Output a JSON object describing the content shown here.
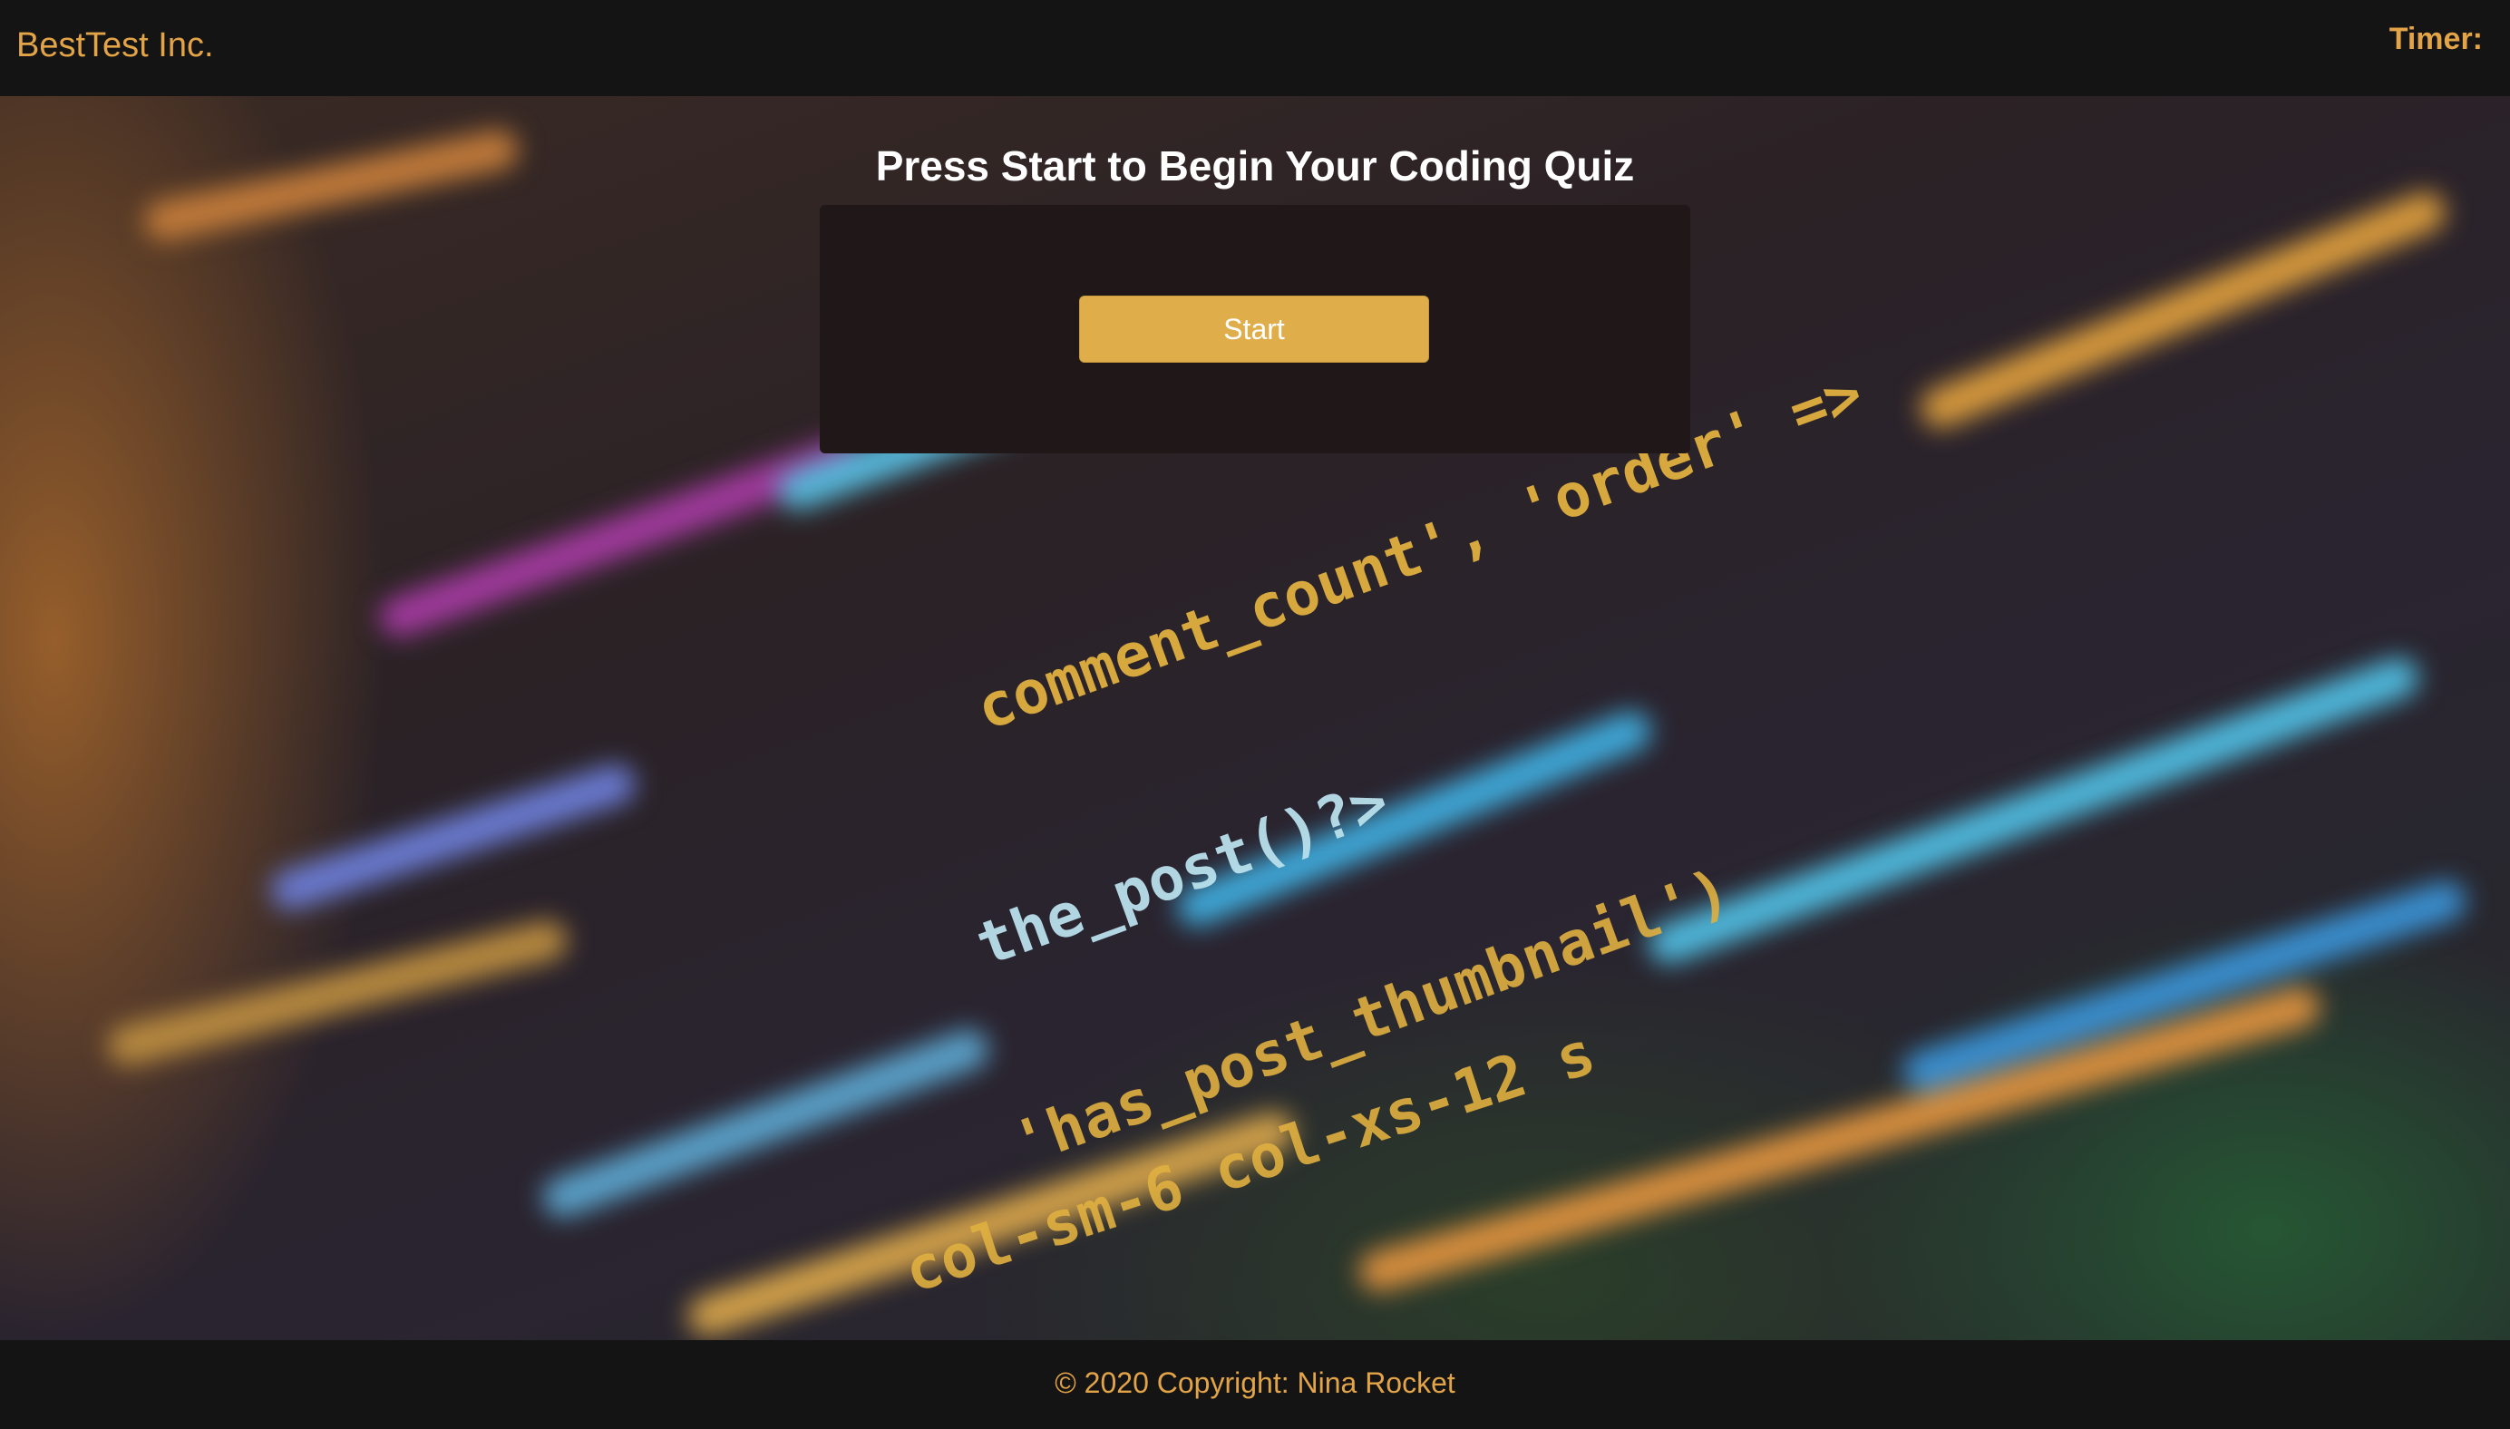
{
  "header": {
    "brand": "BestTest Inc.",
    "timer_label": "Timer:",
    "timer_value": ""
  },
  "quiz": {
    "title": "Press Start to Begin Your Coding Quiz",
    "start_label": "Start"
  },
  "background": {
    "code_fragments": [
      "comment_count', 'order' =>",
      "the_post()?>",
      "'has_post_thumbnail')",
      "col-sm-6 col-xs-12 s"
    ]
  },
  "footer": {
    "copyright": "© 2020 Copyright: Nina Rocket"
  },
  "colors": {
    "accent": "#e2a447",
    "button": "#dfae4b",
    "navbar": "#141414",
    "card": "#1f1718"
  }
}
